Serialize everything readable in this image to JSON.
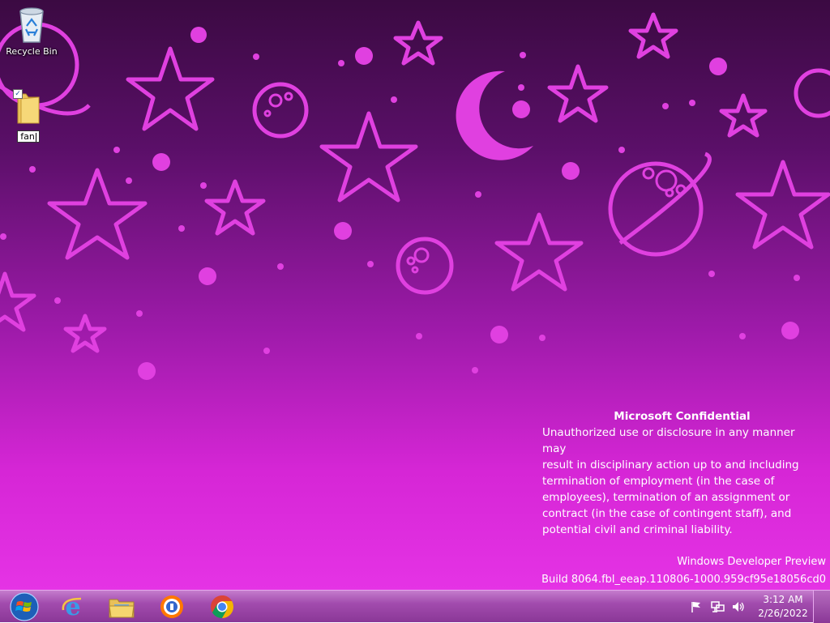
{
  "desktop": {
    "icons": [
      {
        "label": "Recycle Bin",
        "icon": "recycle-bin-icon"
      },
      {
        "label": "fan",
        "icon": "folder-icon",
        "state": "renaming",
        "checked": true
      }
    ]
  },
  "watermark": {
    "title": "Microsoft Confidential",
    "lines": [
      "Unauthorized use or disclosure in any manner may",
      "result in disciplinary action up to and including",
      "termination of employment (in the case of",
      "employees), termination of an assignment or",
      "contract (in the case of contingent staff), and",
      "potential civil and criminal liability."
    ]
  },
  "build_info": {
    "edition": "Windows Developer Preview",
    "build": "Build 8064.fbl_eeap.110806-1000.959cf95e18056cd0"
  },
  "taskbar": {
    "pinned": [
      {
        "name": "start-button",
        "icon": "windows-logo-icon"
      },
      {
        "name": "internet-explorer",
        "icon": "internet-explorer-icon"
      },
      {
        "name": "windows-explorer",
        "icon": "folder-explorer-icon"
      },
      {
        "name": "avast-secure-browser",
        "icon": "avast-browser-icon"
      },
      {
        "name": "google-chrome",
        "icon": "chrome-icon"
      }
    ],
    "tray": {
      "icons": [
        "action-center-flag-icon",
        "network-icon",
        "volume-icon"
      ],
      "time": "3:12 AM",
      "date": "2/26/2022"
    }
  },
  "colors": {
    "accent": "#e533e5",
    "taskbar": "#a24cae",
    "wallpaper_dark": "#3b0a42"
  }
}
